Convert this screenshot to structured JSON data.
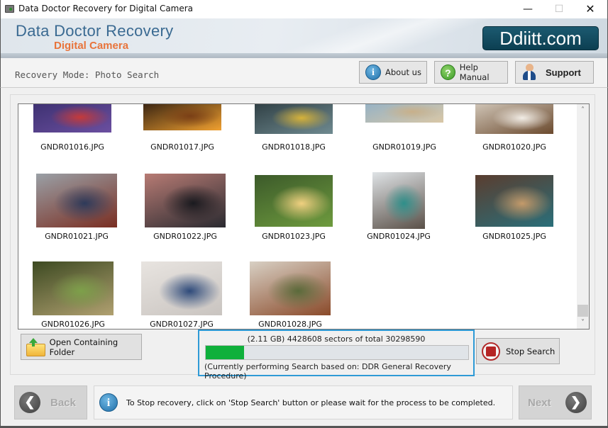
{
  "window": {
    "title": "Data Doctor Recovery for Digital Camera",
    "controls": {
      "minimize": "—",
      "maximize": "☐",
      "close": "✕"
    }
  },
  "banner": {
    "brand_line1": "Data Doctor Recovery",
    "brand_line2": "Digital Camera",
    "logo_text": "Ddiitt.com"
  },
  "modebar": {
    "mode_label": "Recovery Mode: Photo Search",
    "buttons": {
      "about": {
        "label": "About us",
        "icon": "info-icon"
      },
      "help": {
        "label": "Help Manual",
        "icon": "help-icon"
      },
      "support": {
        "label": "Support",
        "icon": "support-person-icon"
      }
    }
  },
  "gallery": {
    "files": [
      {
        "name": "GNDR01016.JPG",
        "colors": [
          "#3a2f6e",
          "#6b4fa0",
          "#c53a3a"
        ]
      },
      {
        "name": "GNDR01017.JPG",
        "colors": [
          "#2a1a10",
          "#f0a030",
          "#7a3f16"
        ]
      },
      {
        "name": "GNDR01018.JPG",
        "colors": [
          "#2b3a3f",
          "#6f8a90",
          "#d6b23a"
        ]
      },
      {
        "name": "GNDR01019.JPG",
        "colors": [
          "#8fb0c8",
          "#d9c7a6",
          "#c8b08a"
        ]
      },
      {
        "name": "GNDR01020.JPG",
        "colors": [
          "#d8cfc2",
          "#6b4a2e",
          "#f2ede6"
        ]
      },
      {
        "name": "GNDR01021.JPG",
        "colors": [
          "#9aa0a6",
          "#7a2e22",
          "#2e3a5a"
        ]
      },
      {
        "name": "GNDR01022.JPG",
        "colors": [
          "#b77b74",
          "#2a2a30",
          "#1a1a1f"
        ]
      },
      {
        "name": "GNDR01023.JPG",
        "colors": [
          "#3c5a2a",
          "#6e9b3e",
          "#f0d080"
        ]
      },
      {
        "name": "GNDR01024.JPG",
        "colors": [
          "#dfe3e6",
          "#5a5048",
          "#2e8f8a"
        ]
      },
      {
        "name": "GNDR01025.JPG",
        "colors": [
          "#5a3d2f",
          "#2a6f7a",
          "#c49a6a"
        ]
      },
      {
        "name": "GNDR01026.JPG",
        "colors": [
          "#3d4a22",
          "#b0a070",
          "#7da04a"
        ]
      },
      {
        "name": "GNDR01027.JPG",
        "colors": [
          "#e8e4e0",
          "#c9c4c0",
          "#2e4a7a"
        ]
      },
      {
        "name": "GNDR01028.JPG",
        "colors": [
          "#d8d0c4",
          "#8a4a2a",
          "#5a6a3a"
        ]
      }
    ],
    "scroll_up": "˄",
    "scroll_down": "˅"
  },
  "actions": {
    "open_folder_label": "Open Containing Folder",
    "stop_search_label": "Stop Search"
  },
  "progress": {
    "status_line": "(2.11 GB) 4428608  sectors  of  total 30298590",
    "size_gb": "2.11 GB",
    "sectors_done": 4428608,
    "sectors_total": 30298590,
    "percent": 14.6,
    "procedure_line": "(Currently performing Search based on:  DDR General Recovery Procedure)",
    "fill_color": "#0fb03b"
  },
  "footer": {
    "back_label": "Back",
    "next_label": "Next",
    "back_arrow": "❮",
    "next_arrow": "❯",
    "message": "To Stop recovery, click on 'Stop Search' button or please wait for the process to be completed."
  },
  "icons": {
    "info_glyph": "i",
    "help_glyph": "?"
  }
}
